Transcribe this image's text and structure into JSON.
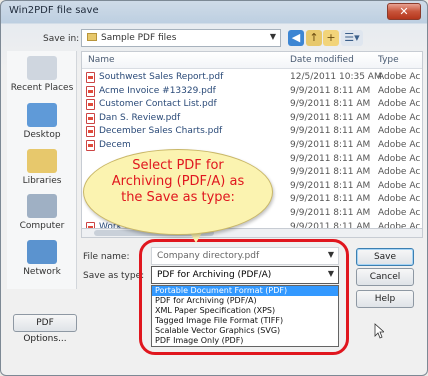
{
  "window": {
    "title": "Win2PDF file save",
    "close_label": "✕"
  },
  "toolbar": {
    "save_in_label": "Save in:",
    "save_in_value": "Sample PDF files"
  },
  "places": [
    {
      "name": "Recent Places",
      "icon": "recent-places-icon",
      "color": "#cfd6df"
    },
    {
      "name": "Desktop",
      "icon": "desktop-icon",
      "color": "#5f9ad8"
    },
    {
      "name": "Libraries",
      "icon": "libraries-icon",
      "color": "#e7c86c"
    },
    {
      "name": "Computer",
      "icon": "computer-icon",
      "color": "#9fb0c4"
    },
    {
      "name": "Network",
      "icon": "network-icon",
      "color": "#5b93cf"
    }
  ],
  "filelist": {
    "columns": [
      "Name",
      "Date modified",
      "Type"
    ],
    "rows": [
      {
        "name": "Southwest Sales Report.pdf",
        "date": "12/5/2011 10:35 AM",
        "type": "Adobe Ac"
      },
      {
        "name": "Acme Invoice #13329.pdf",
        "date": "9/9/2011 8:11 AM",
        "type": "Adobe Ac"
      },
      {
        "name": "Customer Contact List.pdf",
        "date": "9/9/2011 8:11 AM",
        "type": "Adobe Ac"
      },
      {
        "name": "Dan S. Review.pdf",
        "date": "9/9/2011 8:11 AM",
        "type": "Adobe Ac"
      },
      {
        "name": "December Sales Charts.pdf",
        "date": "9/9/2011 8:11 AM",
        "type": "Adobe Ac"
      },
      {
        "name": "Decem",
        "date": "9/9/2011 8:11 AM",
        "type": "Adobe Ac"
      },
      {
        "name": "",
        "date": "9/9/2011 8:11 AM",
        "type": "Adobe Ac"
      },
      {
        "name": "",
        "date": "9/9/2011 8:11 AM",
        "type": "Adobe Ac"
      },
      {
        "name": "",
        "date": "9/9/2011 8:11 AM",
        "type": "Adobe Ac"
      },
      {
        "name": "",
        "date": "9/9/2011 8:11 AM",
        "type": "Adobe Ac"
      },
      {
        "name": "",
        "date": "9/9/2011 8:11 AM",
        "type": "Adobe Ac"
      },
      {
        "name": "Work calendar",
        "date": "9/9/2011 8:11 AM",
        "type": "Adobe Ac"
      }
    ]
  },
  "form": {
    "file_name_label": "File name:",
    "file_name_value": "Company directory.pdf",
    "save_as_label": "Save as type:",
    "save_as_value": "PDF for Archiving (PDF/A)",
    "options": [
      "Portable Document Format (PDF)",
      "PDF for Archiving (PDF/A)",
      "XML Paper Specification (XPS)",
      "Tagged Image File Format (TIFF)",
      "Scalable Vector Graphics (SVG)",
      "PDF Image Only (PDF)"
    ],
    "highlighted_option_index": 0
  },
  "buttons": {
    "save": "Save",
    "cancel": "Cancel",
    "help": "Help",
    "pdf_options": "PDF Options..."
  },
  "callout": {
    "text": "Select PDF for\nArchiving (PDF/A) as\nthe Save as type:"
  }
}
